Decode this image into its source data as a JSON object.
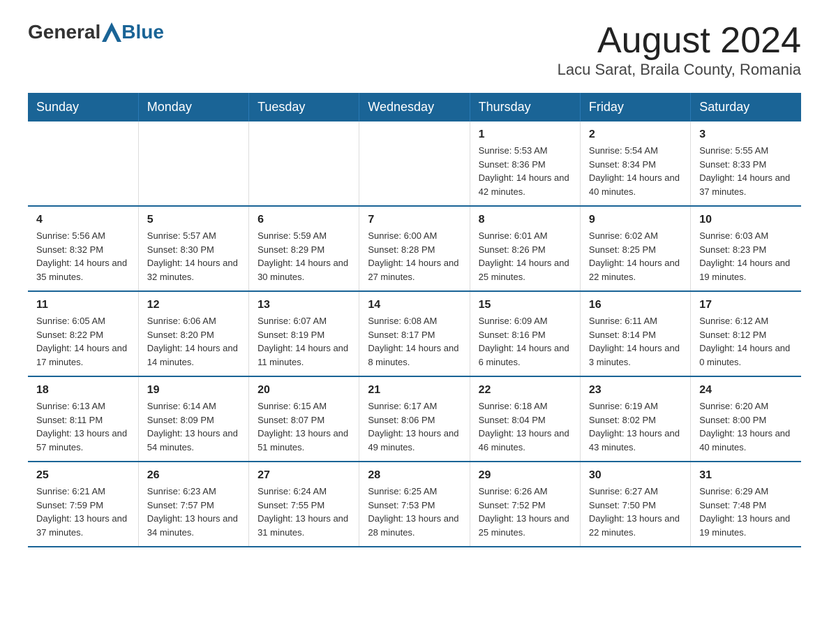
{
  "logo": {
    "general": "General",
    "blue": "Blue"
  },
  "title": "August 2024",
  "subtitle": "Lacu Sarat, Braila County, Romania",
  "days_of_week": [
    "Sunday",
    "Monday",
    "Tuesday",
    "Wednesday",
    "Thursday",
    "Friday",
    "Saturday"
  ],
  "weeks": [
    [
      {
        "day": "",
        "info": ""
      },
      {
        "day": "",
        "info": ""
      },
      {
        "day": "",
        "info": ""
      },
      {
        "day": "",
        "info": ""
      },
      {
        "day": "1",
        "info": "Sunrise: 5:53 AM\nSunset: 8:36 PM\nDaylight: 14 hours and 42 minutes."
      },
      {
        "day": "2",
        "info": "Sunrise: 5:54 AM\nSunset: 8:34 PM\nDaylight: 14 hours and 40 minutes."
      },
      {
        "day": "3",
        "info": "Sunrise: 5:55 AM\nSunset: 8:33 PM\nDaylight: 14 hours and 37 minutes."
      }
    ],
    [
      {
        "day": "4",
        "info": "Sunrise: 5:56 AM\nSunset: 8:32 PM\nDaylight: 14 hours and 35 minutes."
      },
      {
        "day": "5",
        "info": "Sunrise: 5:57 AM\nSunset: 8:30 PM\nDaylight: 14 hours and 32 minutes."
      },
      {
        "day": "6",
        "info": "Sunrise: 5:59 AM\nSunset: 8:29 PM\nDaylight: 14 hours and 30 minutes."
      },
      {
        "day": "7",
        "info": "Sunrise: 6:00 AM\nSunset: 8:28 PM\nDaylight: 14 hours and 27 minutes."
      },
      {
        "day": "8",
        "info": "Sunrise: 6:01 AM\nSunset: 8:26 PM\nDaylight: 14 hours and 25 minutes."
      },
      {
        "day": "9",
        "info": "Sunrise: 6:02 AM\nSunset: 8:25 PM\nDaylight: 14 hours and 22 minutes."
      },
      {
        "day": "10",
        "info": "Sunrise: 6:03 AM\nSunset: 8:23 PM\nDaylight: 14 hours and 19 minutes."
      }
    ],
    [
      {
        "day": "11",
        "info": "Sunrise: 6:05 AM\nSunset: 8:22 PM\nDaylight: 14 hours and 17 minutes."
      },
      {
        "day": "12",
        "info": "Sunrise: 6:06 AM\nSunset: 8:20 PM\nDaylight: 14 hours and 14 minutes."
      },
      {
        "day": "13",
        "info": "Sunrise: 6:07 AM\nSunset: 8:19 PM\nDaylight: 14 hours and 11 minutes."
      },
      {
        "day": "14",
        "info": "Sunrise: 6:08 AM\nSunset: 8:17 PM\nDaylight: 14 hours and 8 minutes."
      },
      {
        "day": "15",
        "info": "Sunrise: 6:09 AM\nSunset: 8:16 PM\nDaylight: 14 hours and 6 minutes."
      },
      {
        "day": "16",
        "info": "Sunrise: 6:11 AM\nSunset: 8:14 PM\nDaylight: 14 hours and 3 minutes."
      },
      {
        "day": "17",
        "info": "Sunrise: 6:12 AM\nSunset: 8:12 PM\nDaylight: 14 hours and 0 minutes."
      }
    ],
    [
      {
        "day": "18",
        "info": "Sunrise: 6:13 AM\nSunset: 8:11 PM\nDaylight: 13 hours and 57 minutes."
      },
      {
        "day": "19",
        "info": "Sunrise: 6:14 AM\nSunset: 8:09 PM\nDaylight: 13 hours and 54 minutes."
      },
      {
        "day": "20",
        "info": "Sunrise: 6:15 AM\nSunset: 8:07 PM\nDaylight: 13 hours and 51 minutes."
      },
      {
        "day": "21",
        "info": "Sunrise: 6:17 AM\nSunset: 8:06 PM\nDaylight: 13 hours and 49 minutes."
      },
      {
        "day": "22",
        "info": "Sunrise: 6:18 AM\nSunset: 8:04 PM\nDaylight: 13 hours and 46 minutes."
      },
      {
        "day": "23",
        "info": "Sunrise: 6:19 AM\nSunset: 8:02 PM\nDaylight: 13 hours and 43 minutes."
      },
      {
        "day": "24",
        "info": "Sunrise: 6:20 AM\nSunset: 8:00 PM\nDaylight: 13 hours and 40 minutes."
      }
    ],
    [
      {
        "day": "25",
        "info": "Sunrise: 6:21 AM\nSunset: 7:59 PM\nDaylight: 13 hours and 37 minutes."
      },
      {
        "day": "26",
        "info": "Sunrise: 6:23 AM\nSunset: 7:57 PM\nDaylight: 13 hours and 34 minutes."
      },
      {
        "day": "27",
        "info": "Sunrise: 6:24 AM\nSunset: 7:55 PM\nDaylight: 13 hours and 31 minutes."
      },
      {
        "day": "28",
        "info": "Sunrise: 6:25 AM\nSunset: 7:53 PM\nDaylight: 13 hours and 28 minutes."
      },
      {
        "day": "29",
        "info": "Sunrise: 6:26 AM\nSunset: 7:52 PM\nDaylight: 13 hours and 25 minutes."
      },
      {
        "day": "30",
        "info": "Sunrise: 6:27 AM\nSunset: 7:50 PM\nDaylight: 13 hours and 22 minutes."
      },
      {
        "day": "31",
        "info": "Sunrise: 6:29 AM\nSunset: 7:48 PM\nDaylight: 13 hours and 19 minutes."
      }
    ]
  ]
}
